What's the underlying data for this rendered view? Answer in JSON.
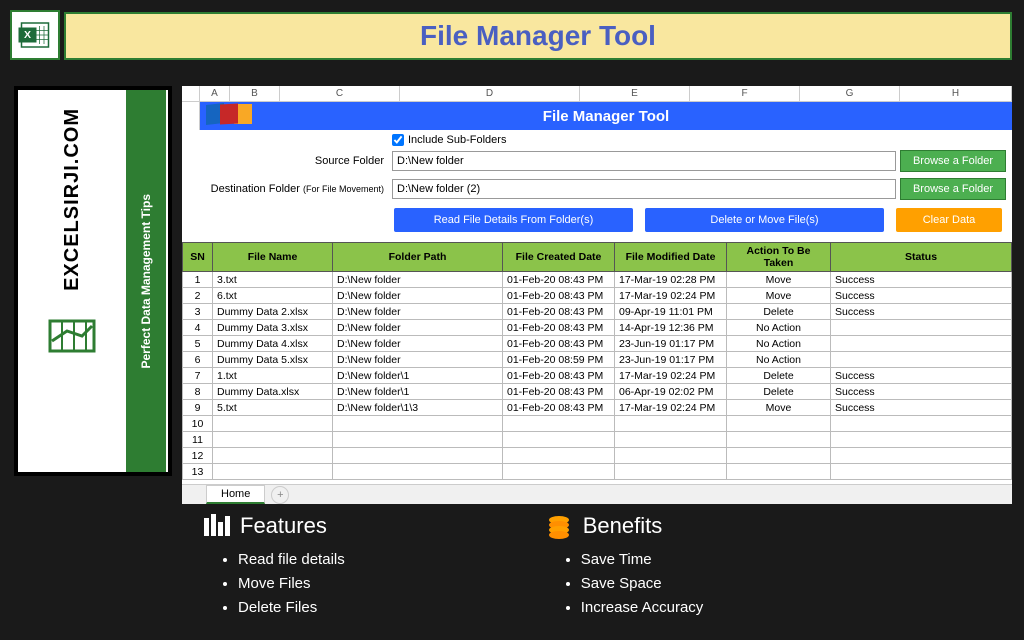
{
  "header": {
    "title": "File Manager Tool"
  },
  "logo": {
    "main": "EXCELSIRJI.COM",
    "tagline": "Perfect Data Management Tips"
  },
  "columns": [
    "A",
    "B",
    "C",
    "D",
    "E",
    "F",
    "G",
    "H"
  ],
  "sheet_title": "File Manager Tool",
  "checkbox": {
    "label": "Include Sub-Folders"
  },
  "source": {
    "label": "Source Folder",
    "value": "D:\\New folder",
    "browse": "Browse a Folder"
  },
  "dest": {
    "label": "Destination Folder",
    "sub": "(For File Movement)",
    "value": "D:\\New folder (2)",
    "browse": "Browse a Folder"
  },
  "buttons": {
    "read": "Read File Details From Folder(s)",
    "delmove": "Delete or Move File(s)",
    "clear": "Clear Data"
  },
  "headers": {
    "sn": "SN",
    "name": "File Name",
    "path": "Folder Path",
    "created": "File Created Date",
    "modified": "File Modified Date",
    "action": "Action To Be Taken",
    "status": "Status"
  },
  "rows": [
    {
      "sn": "1",
      "name": "3.txt",
      "path": "D:\\New folder",
      "created": "01-Feb-20 08:43 PM",
      "modified": "17-Mar-19 02:28 PM",
      "action": "Move",
      "status": "Success"
    },
    {
      "sn": "2",
      "name": "6.txt",
      "path": "D:\\New folder",
      "created": "01-Feb-20 08:43 PM",
      "modified": "17-Mar-19 02:24 PM",
      "action": "Move",
      "status": "Success"
    },
    {
      "sn": "3",
      "name": "Dummy Data 2.xlsx",
      "path": "D:\\New folder",
      "created": "01-Feb-20 08:43 PM",
      "modified": "09-Apr-19 11:01 PM",
      "action": "Delete",
      "status": "Success"
    },
    {
      "sn": "4",
      "name": "Dummy Data 3.xlsx",
      "path": "D:\\New folder",
      "created": "01-Feb-20 08:43 PM",
      "modified": "14-Apr-19 12:36 PM",
      "action": "No Action",
      "status": ""
    },
    {
      "sn": "5",
      "name": "Dummy Data 4.xlsx",
      "path": "D:\\New folder",
      "created": "01-Feb-20 08:43 PM",
      "modified": "23-Jun-19 01:17 PM",
      "action": "No Action",
      "status": ""
    },
    {
      "sn": "6",
      "name": "Dummy Data 5.xlsx",
      "path": "D:\\New folder",
      "created": "01-Feb-20 08:59 PM",
      "modified": "23-Jun-19 01:17 PM",
      "action": "No Action",
      "status": ""
    },
    {
      "sn": "7",
      "name": "1.txt",
      "path": "D:\\New folder\\1",
      "created": "01-Feb-20 08:43 PM",
      "modified": "17-Mar-19 02:24 PM",
      "action": "Delete",
      "status": "Success"
    },
    {
      "sn": "8",
      "name": "Dummy Data.xlsx",
      "path": "D:\\New folder\\1",
      "created": "01-Feb-20 08:43 PM",
      "modified": "06-Apr-19 02:02 PM",
      "action": "Delete",
      "status": "Success"
    },
    {
      "sn": "9",
      "name": "5.txt",
      "path": "D:\\New folder\\1\\3",
      "created": "01-Feb-20 08:43 PM",
      "modified": "17-Mar-19 02:24 PM",
      "action": "Move",
      "status": "Success"
    },
    {
      "sn": "10",
      "name": "",
      "path": "",
      "created": "",
      "modified": "",
      "action": "",
      "status": ""
    },
    {
      "sn": "11",
      "name": "",
      "path": "",
      "created": "",
      "modified": "",
      "action": "",
      "status": ""
    },
    {
      "sn": "12",
      "name": "",
      "path": "",
      "created": "",
      "modified": "",
      "action": "",
      "status": ""
    },
    {
      "sn": "13",
      "name": "",
      "path": "",
      "created": "",
      "modified": "",
      "action": "",
      "status": ""
    }
  ],
  "sheet_tab": "Home",
  "features": {
    "title": "Features",
    "items": [
      "Read file details",
      "Move Files",
      "Delete Files"
    ]
  },
  "benefits": {
    "title": "Benefits",
    "items": [
      "Save Time",
      "Save Space",
      "Increase Accuracy"
    ]
  }
}
